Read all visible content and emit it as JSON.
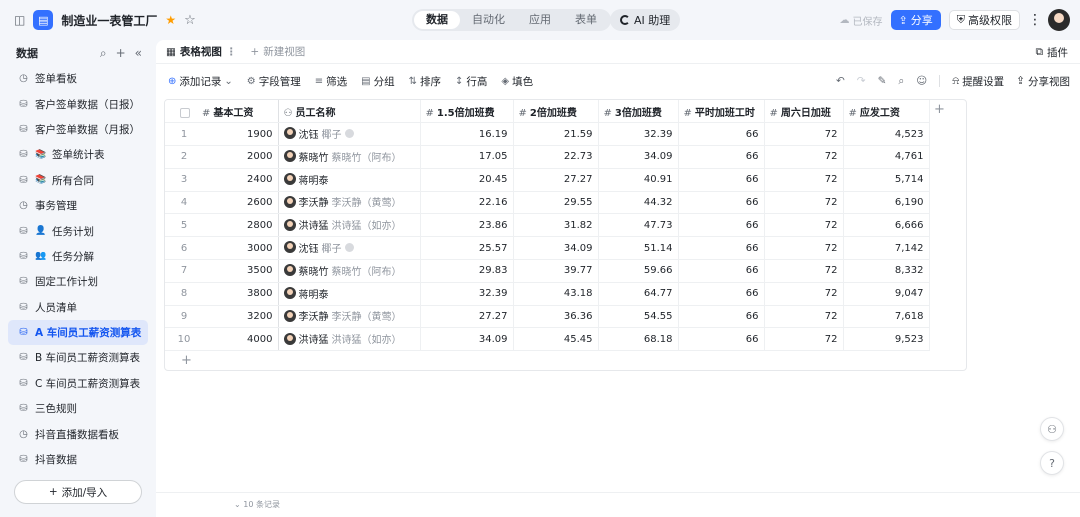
{
  "app": {
    "title": "制造业一表管工厂",
    "tabs": [
      {
        "label": "数据",
        "active": true
      },
      {
        "label": "自动化",
        "active": false
      },
      {
        "label": "应用",
        "active": false
      },
      {
        "label": "表单",
        "active": false
      }
    ],
    "ai_label": "AI 助理",
    "saved_label": "已保存",
    "share_label": "分享",
    "permission_label": "高级权限"
  },
  "sidebar": {
    "title": "数据",
    "items": [
      {
        "label": "签单看板",
        "icon": "dashboard-icon",
        "glyph": "◷",
        "active": false
      },
      {
        "label": "客户签单数据（日报）",
        "icon": "table-icon",
        "glyph": "⛁",
        "active": false
      },
      {
        "label": "客户签单数据（月报）",
        "icon": "table-icon",
        "glyph": "⛁",
        "active": false
      },
      {
        "label": "签单统计表",
        "icon": "table-icon",
        "glyph": "⛁",
        "emoji": "📚",
        "active": false
      },
      {
        "label": "所有合同",
        "icon": "table-icon",
        "glyph": "⛁",
        "emoji": "📚",
        "active": false
      },
      {
        "label": "事务管理",
        "icon": "dashboard-icon",
        "glyph": "◷",
        "active": false
      },
      {
        "label": "任务计划",
        "icon": "table-icon",
        "glyph": "⛁",
        "emoji": "👤",
        "active": false
      },
      {
        "label": "任务分解",
        "icon": "table-icon",
        "glyph": "⛁",
        "emoji": "👥",
        "active": false
      },
      {
        "label": "固定工作计划",
        "icon": "table-icon",
        "glyph": "⛁",
        "active": false
      },
      {
        "label": "人员清单",
        "icon": "table-icon",
        "glyph": "⛁",
        "active": false
      },
      {
        "label": "A 车间员工薪资测算表",
        "icon": "table-icon",
        "glyph": "⛁",
        "active": true
      },
      {
        "label": "B 车间员工薪资测算表",
        "icon": "table-icon",
        "glyph": "⛁",
        "active": false
      },
      {
        "label": "C 车间员工薪资测算表",
        "icon": "table-icon",
        "glyph": "⛁",
        "active": false
      },
      {
        "label": "三色规则",
        "icon": "table-icon",
        "glyph": "⛁",
        "active": false
      },
      {
        "label": "抖音直播数据看板",
        "icon": "dashboard-icon",
        "glyph": "◷",
        "active": false
      },
      {
        "label": "抖音数据",
        "icon": "table-icon",
        "glyph": "⛁",
        "active": false
      }
    ],
    "add_import_label": "添加/导入"
  },
  "views": {
    "active_label": "表格视图",
    "new_label": "新建视图",
    "plugin_label": "插件"
  },
  "toolbar": {
    "add_record": "添加记录",
    "field_manage": "字段管理",
    "filter": "筛选",
    "group": "分组",
    "sort": "排序",
    "row_height": "行高",
    "fill_color": "填色",
    "reminder": "提醒设置",
    "share_view": "分享视图"
  },
  "table": {
    "columns": [
      "基本工资",
      "员工名称",
      "1.5倍加班费",
      "2倍加班费",
      "3倍加班费",
      "平时加班工时",
      "周六日加班",
      "应发工资"
    ],
    "rows": [
      {
        "idx": "1",
        "base": "1900",
        "name": "沈钰",
        "alias": "椰子",
        "has_blob": true,
        "ot15": "16.19",
        "ot2": "21.59",
        "ot3": "32.39",
        "hours": "66",
        "weekend": "72",
        "pay": "4,523"
      },
      {
        "idx": "2",
        "base": "2000",
        "name": "蔡晓竹",
        "alias": "蔡晓竹（阿布）",
        "has_blob": false,
        "ot15": "17.05",
        "ot2": "22.73",
        "ot3": "34.09",
        "hours": "66",
        "weekend": "72",
        "pay": "4,761"
      },
      {
        "idx": "3",
        "base": "2400",
        "name": "蒋明泰",
        "alias": "",
        "has_blob": false,
        "ot15": "20.45",
        "ot2": "27.27",
        "ot3": "40.91",
        "hours": "66",
        "weekend": "72",
        "pay": "5,714"
      },
      {
        "idx": "4",
        "base": "2600",
        "name": "李沃静",
        "alias": "李沃静（黄莺）",
        "has_blob": false,
        "ot15": "22.16",
        "ot2": "29.55",
        "ot3": "44.32",
        "hours": "66",
        "weekend": "72",
        "pay": "6,190"
      },
      {
        "idx": "5",
        "base": "2800",
        "name": "洪诗猛",
        "alias": "洪诗猛（如亦）",
        "has_blob": false,
        "ot15": "23.86",
        "ot2": "31.82",
        "ot3": "47.73",
        "hours": "66",
        "weekend": "72",
        "pay": "6,666"
      },
      {
        "idx": "6",
        "base": "3000",
        "name": "沈钰",
        "alias": "椰子",
        "has_blob": true,
        "ot15": "25.57",
        "ot2": "34.09",
        "ot3": "51.14",
        "hours": "66",
        "weekend": "72",
        "pay": "7,142"
      },
      {
        "idx": "7",
        "base": "3500",
        "name": "蔡晓竹",
        "alias": "蔡晓竹（阿布）",
        "has_blob": false,
        "ot15": "29.83",
        "ot2": "39.77",
        "ot3": "59.66",
        "hours": "66",
        "weekend": "72",
        "pay": "8,332"
      },
      {
        "idx": "8",
        "base": "3800",
        "name": "蒋明泰",
        "alias": "",
        "has_blob": false,
        "ot15": "32.39",
        "ot2": "43.18",
        "ot3": "64.77",
        "hours": "66",
        "weekend": "72",
        "pay": "9,047"
      },
      {
        "idx": "9",
        "base": "3200",
        "name": "李沃静",
        "alias": "李沃静（黄莺）",
        "has_blob": false,
        "ot15": "27.27",
        "ot2": "36.36",
        "ot3": "54.55",
        "hours": "66",
        "weekend": "72",
        "pay": "7,618"
      },
      {
        "idx": "10",
        "base": "4000",
        "name": "洪诗猛",
        "alias": "洪诗猛（如亦）",
        "has_blob": false,
        "ot15": "34.09",
        "ot2": "45.45",
        "ot3": "68.18",
        "hours": "66",
        "weekend": "72",
        "pay": "9,523"
      }
    ],
    "record_count": "10 条记录"
  },
  "colors": {
    "accent": "#3370ff",
    "active_nav_bg": "#dfe7fb",
    "active_nav_text": "#1456f0",
    "star": "#ff9d00"
  }
}
